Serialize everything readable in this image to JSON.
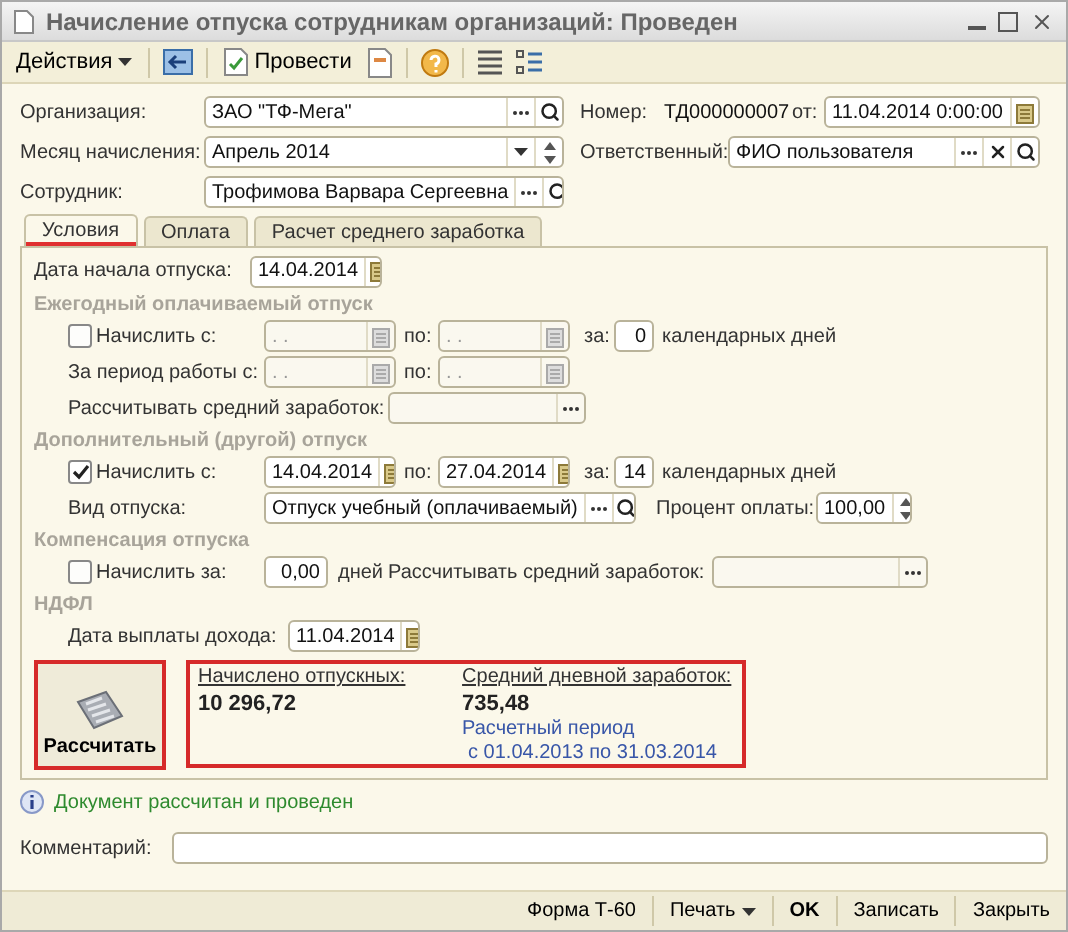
{
  "window": {
    "title": "Начисление отпуска сотрудникам организаций: Проведен"
  },
  "toolbar": {
    "actions": "Действия",
    "post": "Провести"
  },
  "header": {
    "organization": {
      "label": "Организация:",
      "value": "ЗАО \"ТФ-Мега\""
    },
    "month": {
      "label": "Месяц начисления:",
      "value": "Апрель 2014"
    },
    "employee": {
      "label": "Сотрудник:",
      "value": "Трофимова Варвара Сергеевна"
    },
    "number": {
      "label": "Номер:",
      "value": "ТД000000007"
    },
    "date": {
      "label": "от:",
      "value": "11.04.2014  0:00:00"
    },
    "responsible": {
      "label": "Ответственный:",
      "value": "ФИО пользователя"
    }
  },
  "tabs": [
    {
      "label": "Условия",
      "selected": true
    },
    {
      "label": "Оплата",
      "selected": false
    },
    {
      "label": "Расчет среднего заработка",
      "selected": false
    }
  ],
  "conditions": {
    "start_date": {
      "label": "Дата начала отпуска:",
      "value": "14.04.2014"
    },
    "annual": {
      "title": "Ежегодный оплачиваемый отпуск",
      "accrue": {
        "label": "Начислить с:",
        "checked": false
      },
      "from": ". .",
      "to_label": "по:",
      "to": ". .",
      "days_label": "за:",
      "days": "0",
      "unit": "календарных дней",
      "period_label": "За период работы с:",
      "period_from": ". .",
      "period_to_label": "по:",
      "period_to": ". .",
      "avg_label": "Рассчитывать средний заработок:"
    },
    "additional": {
      "title": "Дополнительный (другой) отпуск",
      "accrue": {
        "label": "Начислить с:",
        "checked": true
      },
      "from": "14.04.2014",
      "to_label": "по:",
      "to": "27.04.2014",
      "days_label": "за:",
      "days": "14",
      "unit": "календарных дней",
      "leave_type_label": "Вид отпуска:",
      "leave_type": "Отпуск учебный (оплачиваемый)",
      "percent_label": "Процент оплаты:",
      "percent": "100,00"
    },
    "compensation": {
      "title": "Компенсация отпуска",
      "accrue": {
        "label": "Начислить за:",
        "checked": false
      },
      "days": "0,00",
      "unit": "дней",
      "avg_label": "Рассчитывать средний заработок:"
    },
    "ndfl": {
      "title": "НДФЛ",
      "label": "Дата выплаты дохода:",
      "value": "11.04.2014"
    }
  },
  "results": {
    "calculate": "Рассчитать",
    "accrued_label": "Начислено отпускных:",
    "accrued": "10 296,72",
    "avg_label": "Средний дневной заработок:",
    "avg": "735,48",
    "period_title": "Расчетный период",
    "period": "с 01.04.2013 по 31.03.2014"
  },
  "info": "Документ рассчитан и проведен",
  "comment": {
    "label": "Комментарий:"
  },
  "footer": [
    {
      "label": "Форма Т-60",
      "kind": "plain"
    },
    {
      "label": "Печать",
      "kind": "menu"
    },
    {
      "label": "OK",
      "kind": "bold"
    },
    {
      "label": "Записать",
      "kind": "plain"
    },
    {
      "label": "Закрыть",
      "kind": "plain"
    }
  ]
}
